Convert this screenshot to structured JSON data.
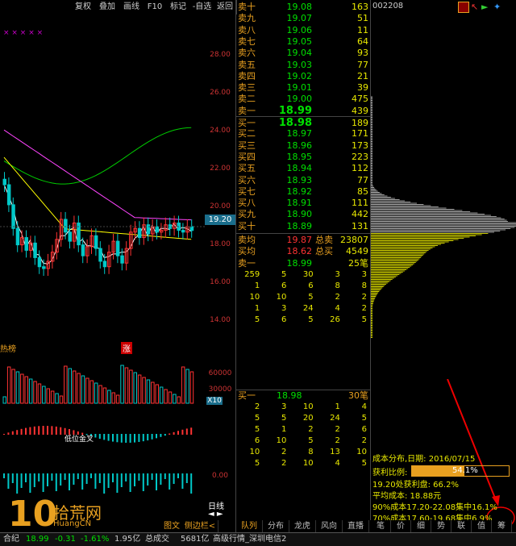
{
  "toolbar": [
    "复权",
    "叠加",
    "画线",
    "F10",
    "标记",
    "-自选",
    "返回"
  ],
  "price_axis": [
    "28.00",
    "26.00",
    "24.00",
    "22.00",
    "20.00",
    "18.00",
    "16.00",
    "14.00"
  ],
  "price_tag": "19.20",
  "vol_axis": [
    "60000",
    "30000",
    "X10"
  ],
  "macd_axis": [
    "0.00"
  ],
  "chart_labels": {
    "left_marker": "热榜",
    "right_marker": "涨",
    "macd_note": "低位金叉",
    "day_line": "日线"
  },
  "sell_rows": [
    {
      "label": "卖十",
      "price": "19.08",
      "vol": "163"
    },
    {
      "label": "卖九",
      "price": "19.07",
      "vol": "51"
    },
    {
      "label": "卖八",
      "price": "19.06",
      "vol": "11"
    },
    {
      "label": "卖七",
      "price": "19.05",
      "vol": "64"
    },
    {
      "label": "卖六",
      "price": "19.04",
      "vol": "93"
    },
    {
      "label": "卖五",
      "price": "19.03",
      "vol": "77"
    },
    {
      "label": "卖四",
      "price": "19.02",
      "vol": "21"
    },
    {
      "label": "卖三",
      "price": "19.01",
      "vol": "39"
    },
    {
      "label": "卖二",
      "price": "19.00",
      "vol": "475"
    },
    {
      "label": "卖一",
      "price": "18.99",
      "vol": "439"
    }
  ],
  "buy_rows": [
    {
      "label": "买一",
      "price": "18.98",
      "vol": "189"
    },
    {
      "label": "买二",
      "price": "18.97",
      "vol": "171"
    },
    {
      "label": "买三",
      "price": "18.96",
      "vol": "173"
    },
    {
      "label": "买四",
      "price": "18.95",
      "vol": "223"
    },
    {
      "label": "买五",
      "price": "18.94",
      "vol": "112"
    },
    {
      "label": "买六",
      "price": "18.93",
      "vol": "77"
    },
    {
      "label": "买七",
      "price": "18.92",
      "vol": "85"
    },
    {
      "label": "买八",
      "price": "18.91",
      "vol": "111"
    },
    {
      "label": "买九",
      "price": "18.90",
      "vol": "442"
    },
    {
      "label": "买十",
      "price": "18.89",
      "vol": "131"
    }
  ],
  "summary": [
    {
      "l1": "卖均",
      "v1": "19.87",
      "l2": "总卖",
      "v2": "23807"
    },
    {
      "l1": "买均",
      "v1": "18.62",
      "l2": "总买",
      "v2": "4549"
    },
    {
      "l1": "卖一",
      "v1": "18.99",
      "l2": "",
      "v2": "25笔"
    }
  ],
  "sell_queue": [
    [
      "259",
      "5",
      "30",
      "3",
      "3"
    ],
    [
      "1",
      "6",
      "6",
      "8",
      "8"
    ],
    [
      "10",
      "10",
      "5",
      "2",
      "2"
    ],
    [
      "1",
      "3",
      "24",
      "4",
      "2"
    ],
    [
      "5",
      "6",
      "5",
      "26",
      "5"
    ]
  ],
  "buy_queue_header": {
    "label": "买一",
    "price": "18.98",
    "count": "30笔"
  },
  "buy_queue": [
    [
      "2",
      "3",
      "10",
      "1",
      "4"
    ],
    [
      "5",
      "5",
      "20",
      "24",
      "5"
    ],
    [
      "5",
      "1",
      "2",
      "2",
      "6"
    ],
    [
      "6",
      "10",
      "5",
      "2",
      "2"
    ],
    [
      "10",
      "2",
      "8",
      "13",
      "10"
    ],
    [
      "5",
      "2",
      "10",
      "4",
      "5"
    ]
  ],
  "stock_code": "002208",
  "cost": {
    "title": "成本分布,日期:",
    "date": "2016/07/15",
    "profit_label": "获利比例:",
    "profit_value": "54.1%",
    "line2": "19.20处获利盘: 66.2%",
    "line3": "平均成本: 18.88元",
    "line4": "90%成本17.20-22.08集中16.1%",
    "line5": "70%成本17.60-19.68集中6.9%"
  },
  "chart_tabs": [
    "图文F10",
    "侧边栏<"
  ],
  "right_tabs": [
    "队列",
    "分布",
    "龙虎",
    "风向",
    "直播"
  ],
  "tiny_tabs": [
    "笔",
    "价",
    "细",
    "势",
    "联",
    "值",
    "筹"
  ],
  "status": {
    "name": "合纪",
    "price": "18.99",
    "change": "-0.31",
    "pct": "-1.61%",
    "amount": "1.95亿",
    "total_label": "总成交",
    "total": "5681亿",
    "ticker": "高级行情_深圳电信2"
  },
  "watermark": {
    "big": "10",
    "site": "拾荒网",
    "url": "HuangCN"
  },
  "colors": {
    "up": "#ff3333",
    "down": "#00c8c8",
    "ma5": "#ffffff",
    "ma10": "#ffff00",
    "ma20": "#ff44ff",
    "ma60": "#00cc00",
    "accent": "#e8a020"
  }
}
